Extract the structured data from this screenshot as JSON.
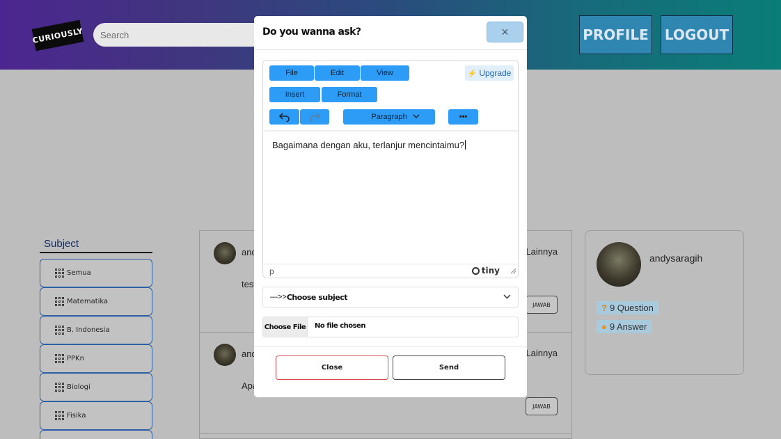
{
  "header": {
    "logo_text": "CURIOUSLY",
    "search_placeholder": "Search",
    "profile_button": "PROFILE",
    "logout_button": "LOGOUT"
  },
  "sidebar": {
    "title": "Subject",
    "items": [
      {
        "label": "Semua"
      },
      {
        "label": "Matematika"
      },
      {
        "label": "B. Indonesia"
      },
      {
        "label": "PPKn"
      },
      {
        "label": "Biologi"
      },
      {
        "label": "Fisika"
      }
    ]
  },
  "feed": {
    "posts": [
      {
        "user": "and",
        "category": "Lainnya",
        "text": "test",
        "answer_button": "JAWAB"
      },
      {
        "user": "and",
        "category": "Lainnya",
        "text": "Apa",
        "answer_button": "JAWAB"
      }
    ]
  },
  "profile_card": {
    "username": "andysaragih",
    "questions": "9 Question",
    "answers": "9 Answer"
  },
  "modal": {
    "title": "Do you wanna ask?",
    "close_icon": "×",
    "editor": {
      "menu": [
        "File",
        "Edit",
        "View",
        "Insert",
        "Format"
      ],
      "upgrade_label": "Upgrade",
      "block_format": "Paragraph",
      "more_label": "•••",
      "content": "Bagaimana dengan aku, terlanjur mencintaimu?",
      "status_path": "p",
      "brand": "tiny"
    },
    "subject_select": {
      "prefix": "—>>",
      "value": "Choose subject"
    },
    "file_input": {
      "button": "Choose File",
      "status": "No file chosen"
    },
    "close_button": "Close",
    "send_button": "Send"
  },
  "colors": {
    "header_gradient_start": "#4c2690",
    "header_gradient_end": "#0a7d78",
    "toolbar_button": "#2d9cf7",
    "header_button": "#2f86b0",
    "close_border": "#d34a4a"
  }
}
